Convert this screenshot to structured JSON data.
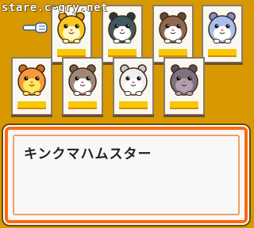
{
  "watermark": "stare.c-gry.net",
  "hamsters": [
    {
      "id": "row1-1",
      "body": "#f8c820",
      "shade": "#e89810",
      "face": "#fff8c0"
    },
    {
      "id": "row1-2",
      "body": "#405860",
      "shade": "#283840",
      "face": "#ffffff"
    },
    {
      "id": "row1-3",
      "body": "#906850",
      "shade": "#684830",
      "face": "#ffffff"
    },
    {
      "id": "row1-4",
      "body": "#a8c0f0",
      "shade": "#7890d0",
      "face": "#ffffff"
    },
    {
      "id": "row2-1",
      "body": "#f89838",
      "shade": "#d86818",
      "face": "#ffe860"
    },
    {
      "id": "row2-2",
      "body": "#a08878",
      "shade": "#786050",
      "face": "#ffffff"
    },
    {
      "id": "row2-3",
      "body": "#f0f0f0",
      "shade": "#c8c8c8",
      "face": "#ffffff"
    },
    {
      "id": "row2-4",
      "body": "#807080",
      "shade": "#605060",
      "face": "#b0a0b0"
    }
  ],
  "selected_index": 0,
  "dialog": {
    "name": "キンクマハムスター"
  },
  "colors": {
    "background": "#d89800",
    "dialog_border": "#ff6a10",
    "name_bar": "#f8c800"
  },
  "icons": {
    "pointer": "pointing-hand-icon"
  }
}
